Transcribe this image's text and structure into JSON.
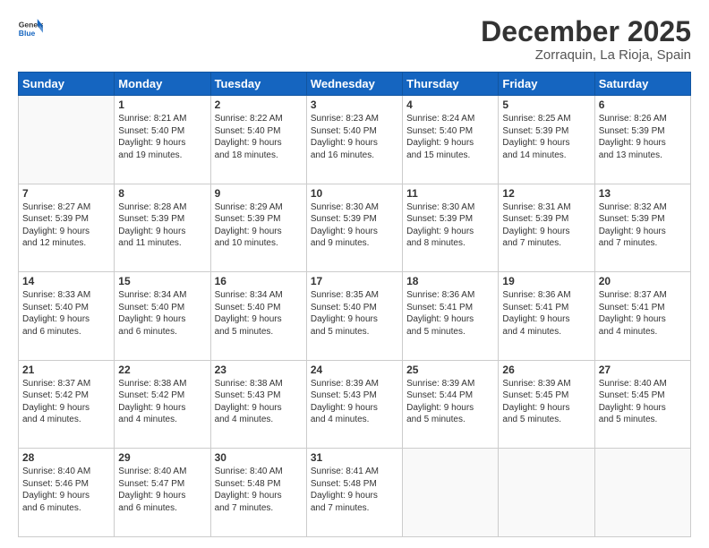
{
  "header": {
    "logo_general": "General",
    "logo_blue": "Blue",
    "month": "December 2025",
    "location": "Zorraquin, La Rioja, Spain"
  },
  "days_of_week": [
    "Sunday",
    "Monday",
    "Tuesday",
    "Wednesday",
    "Thursday",
    "Friday",
    "Saturday"
  ],
  "weeks": [
    [
      {
        "day": "",
        "info": ""
      },
      {
        "day": "1",
        "info": "Sunrise: 8:21 AM\nSunset: 5:40 PM\nDaylight: 9 hours\nand 19 minutes."
      },
      {
        "day": "2",
        "info": "Sunrise: 8:22 AM\nSunset: 5:40 PM\nDaylight: 9 hours\nand 18 minutes."
      },
      {
        "day": "3",
        "info": "Sunrise: 8:23 AM\nSunset: 5:40 PM\nDaylight: 9 hours\nand 16 minutes."
      },
      {
        "day": "4",
        "info": "Sunrise: 8:24 AM\nSunset: 5:40 PM\nDaylight: 9 hours\nand 15 minutes."
      },
      {
        "day": "5",
        "info": "Sunrise: 8:25 AM\nSunset: 5:39 PM\nDaylight: 9 hours\nand 14 minutes."
      },
      {
        "day": "6",
        "info": "Sunrise: 8:26 AM\nSunset: 5:39 PM\nDaylight: 9 hours\nand 13 minutes."
      }
    ],
    [
      {
        "day": "7",
        "info": "Sunrise: 8:27 AM\nSunset: 5:39 PM\nDaylight: 9 hours\nand 12 minutes."
      },
      {
        "day": "8",
        "info": "Sunrise: 8:28 AM\nSunset: 5:39 PM\nDaylight: 9 hours\nand 11 minutes."
      },
      {
        "day": "9",
        "info": "Sunrise: 8:29 AM\nSunset: 5:39 PM\nDaylight: 9 hours\nand 10 minutes."
      },
      {
        "day": "10",
        "info": "Sunrise: 8:30 AM\nSunset: 5:39 PM\nDaylight: 9 hours\nand 9 minutes."
      },
      {
        "day": "11",
        "info": "Sunrise: 8:30 AM\nSunset: 5:39 PM\nDaylight: 9 hours\nand 8 minutes."
      },
      {
        "day": "12",
        "info": "Sunrise: 8:31 AM\nSunset: 5:39 PM\nDaylight: 9 hours\nand 7 minutes."
      },
      {
        "day": "13",
        "info": "Sunrise: 8:32 AM\nSunset: 5:39 PM\nDaylight: 9 hours\nand 7 minutes."
      }
    ],
    [
      {
        "day": "14",
        "info": "Sunrise: 8:33 AM\nSunset: 5:40 PM\nDaylight: 9 hours\nand 6 minutes."
      },
      {
        "day": "15",
        "info": "Sunrise: 8:34 AM\nSunset: 5:40 PM\nDaylight: 9 hours\nand 6 minutes."
      },
      {
        "day": "16",
        "info": "Sunrise: 8:34 AM\nSunset: 5:40 PM\nDaylight: 9 hours\nand 5 minutes."
      },
      {
        "day": "17",
        "info": "Sunrise: 8:35 AM\nSunset: 5:40 PM\nDaylight: 9 hours\nand 5 minutes."
      },
      {
        "day": "18",
        "info": "Sunrise: 8:36 AM\nSunset: 5:41 PM\nDaylight: 9 hours\nand 5 minutes."
      },
      {
        "day": "19",
        "info": "Sunrise: 8:36 AM\nSunset: 5:41 PM\nDaylight: 9 hours\nand 4 minutes."
      },
      {
        "day": "20",
        "info": "Sunrise: 8:37 AM\nSunset: 5:41 PM\nDaylight: 9 hours\nand 4 minutes."
      }
    ],
    [
      {
        "day": "21",
        "info": "Sunrise: 8:37 AM\nSunset: 5:42 PM\nDaylight: 9 hours\nand 4 minutes."
      },
      {
        "day": "22",
        "info": "Sunrise: 8:38 AM\nSunset: 5:42 PM\nDaylight: 9 hours\nand 4 minutes."
      },
      {
        "day": "23",
        "info": "Sunrise: 8:38 AM\nSunset: 5:43 PM\nDaylight: 9 hours\nand 4 minutes."
      },
      {
        "day": "24",
        "info": "Sunrise: 8:39 AM\nSunset: 5:43 PM\nDaylight: 9 hours\nand 4 minutes."
      },
      {
        "day": "25",
        "info": "Sunrise: 8:39 AM\nSunset: 5:44 PM\nDaylight: 9 hours\nand 5 minutes."
      },
      {
        "day": "26",
        "info": "Sunrise: 8:39 AM\nSunset: 5:45 PM\nDaylight: 9 hours\nand 5 minutes."
      },
      {
        "day": "27",
        "info": "Sunrise: 8:40 AM\nSunset: 5:45 PM\nDaylight: 9 hours\nand 5 minutes."
      }
    ],
    [
      {
        "day": "28",
        "info": "Sunrise: 8:40 AM\nSunset: 5:46 PM\nDaylight: 9 hours\nand 6 minutes."
      },
      {
        "day": "29",
        "info": "Sunrise: 8:40 AM\nSunset: 5:47 PM\nDaylight: 9 hours\nand 6 minutes."
      },
      {
        "day": "30",
        "info": "Sunrise: 8:40 AM\nSunset: 5:48 PM\nDaylight: 9 hours\nand 7 minutes."
      },
      {
        "day": "31",
        "info": "Sunrise: 8:41 AM\nSunset: 5:48 PM\nDaylight: 9 hours\nand 7 minutes."
      },
      {
        "day": "",
        "info": ""
      },
      {
        "day": "",
        "info": ""
      },
      {
        "day": "",
        "info": ""
      }
    ]
  ]
}
